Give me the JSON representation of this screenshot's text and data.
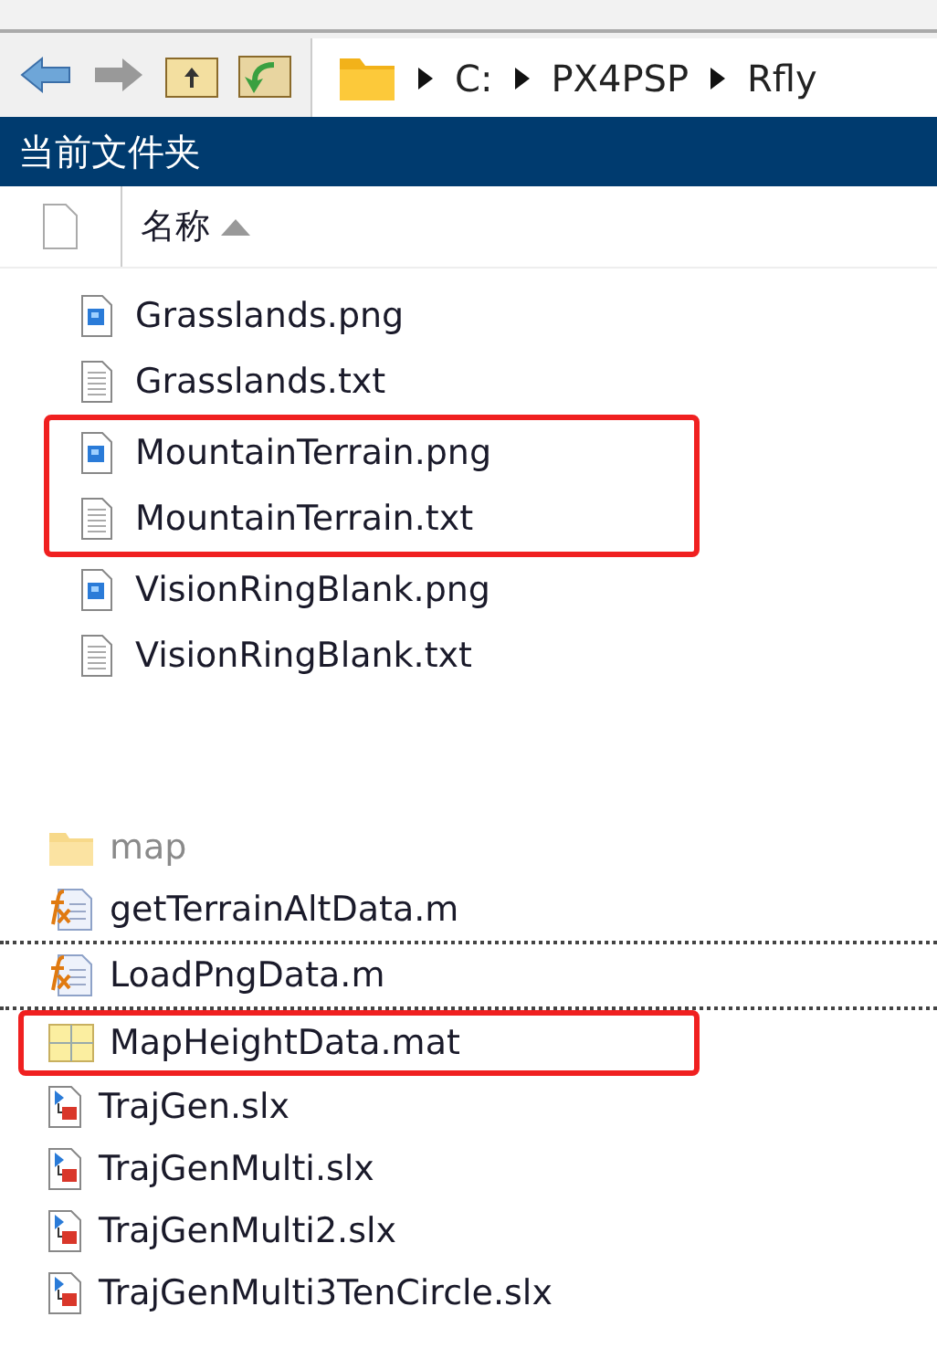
{
  "toolbar": {
    "path": [
      "C:",
      "PX4PSP",
      "Rfly"
    ]
  },
  "panel_title": "当前文件夹",
  "header": {
    "name_column": "名称",
    "sorted_ascending": true
  },
  "files": [
    {
      "name": "Grasslands.png",
      "kind": "image",
      "highlighted": false
    },
    {
      "name": "Grasslands.txt",
      "kind": "text",
      "highlighted": false
    },
    {
      "name": "MountainTerrain.png",
      "kind": "image",
      "highlighted": true
    },
    {
      "name": "MountainTerrain.txt",
      "kind": "text",
      "highlighted": true
    },
    {
      "name": "VisionRingBlank.png",
      "kind": "image",
      "highlighted": false
    },
    {
      "name": "VisionRingBlank.txt",
      "kind": "text",
      "highlighted": false
    }
  ],
  "files_2": [
    {
      "name": "map",
      "kind": "folder",
      "dimmed": true,
      "focused": false,
      "highlighted": false
    },
    {
      "name": "getTerrainAltData.m",
      "kind": "function",
      "dimmed": false,
      "focused": true,
      "highlighted": false
    },
    {
      "name": "LoadPngData.m",
      "kind": "function",
      "dimmed": false,
      "focused": true,
      "highlighted": false
    },
    {
      "name": "MapHeightData.mat",
      "kind": "mat",
      "dimmed": false,
      "focused": false,
      "highlighted": true
    },
    {
      "name": "TrajGen.slx",
      "kind": "model",
      "dimmed": false,
      "focused": false,
      "highlighted": false
    },
    {
      "name": "TrajGenMulti.slx",
      "kind": "model",
      "dimmed": false,
      "focused": false,
      "highlighted": false
    },
    {
      "name": "TrajGenMulti2.slx",
      "kind": "model",
      "dimmed": false,
      "focused": false,
      "highlighted": false
    },
    {
      "name": "TrajGenMulti3TenCircle.slx",
      "kind": "model",
      "dimmed": false,
      "focused": false,
      "highlighted": false
    }
  ]
}
